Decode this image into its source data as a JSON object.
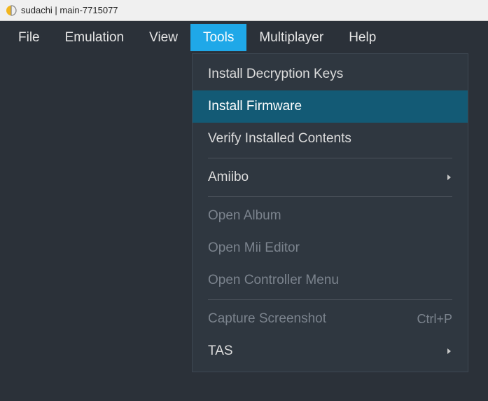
{
  "window": {
    "title": "sudachi | main-7715077"
  },
  "menubar": [
    {
      "label": "File",
      "active": false
    },
    {
      "label": "Emulation",
      "active": false
    },
    {
      "label": "View",
      "active": false
    },
    {
      "label": "Tools",
      "active": true
    },
    {
      "label": "Multiplayer",
      "active": false
    },
    {
      "label": "Help",
      "active": false
    }
  ],
  "dropdown": {
    "items": [
      {
        "label": "Install Decryption Keys",
        "enabled": true,
        "highlight": false,
        "submenu": false,
        "shortcut": ""
      },
      {
        "label": "Install Firmware",
        "enabled": true,
        "highlight": true,
        "submenu": false,
        "shortcut": ""
      },
      {
        "label": "Verify Installed Contents",
        "enabled": true,
        "highlight": false,
        "submenu": false,
        "shortcut": ""
      },
      {
        "separator": true
      },
      {
        "label": "Amiibo",
        "enabled": true,
        "highlight": false,
        "submenu": true,
        "shortcut": ""
      },
      {
        "separator": true
      },
      {
        "label": "Open Album",
        "enabled": false,
        "highlight": false,
        "submenu": false,
        "shortcut": ""
      },
      {
        "label": "Open Mii Editor",
        "enabled": false,
        "highlight": false,
        "submenu": false,
        "shortcut": ""
      },
      {
        "label": "Open Controller Menu",
        "enabled": false,
        "highlight": false,
        "submenu": false,
        "shortcut": ""
      },
      {
        "separator": true
      },
      {
        "label": "Capture Screenshot",
        "enabled": false,
        "highlight": false,
        "submenu": false,
        "shortcut": "Ctrl+P"
      },
      {
        "label": "TAS",
        "enabled": true,
        "highlight": false,
        "submenu": true,
        "shortcut": ""
      }
    ]
  }
}
